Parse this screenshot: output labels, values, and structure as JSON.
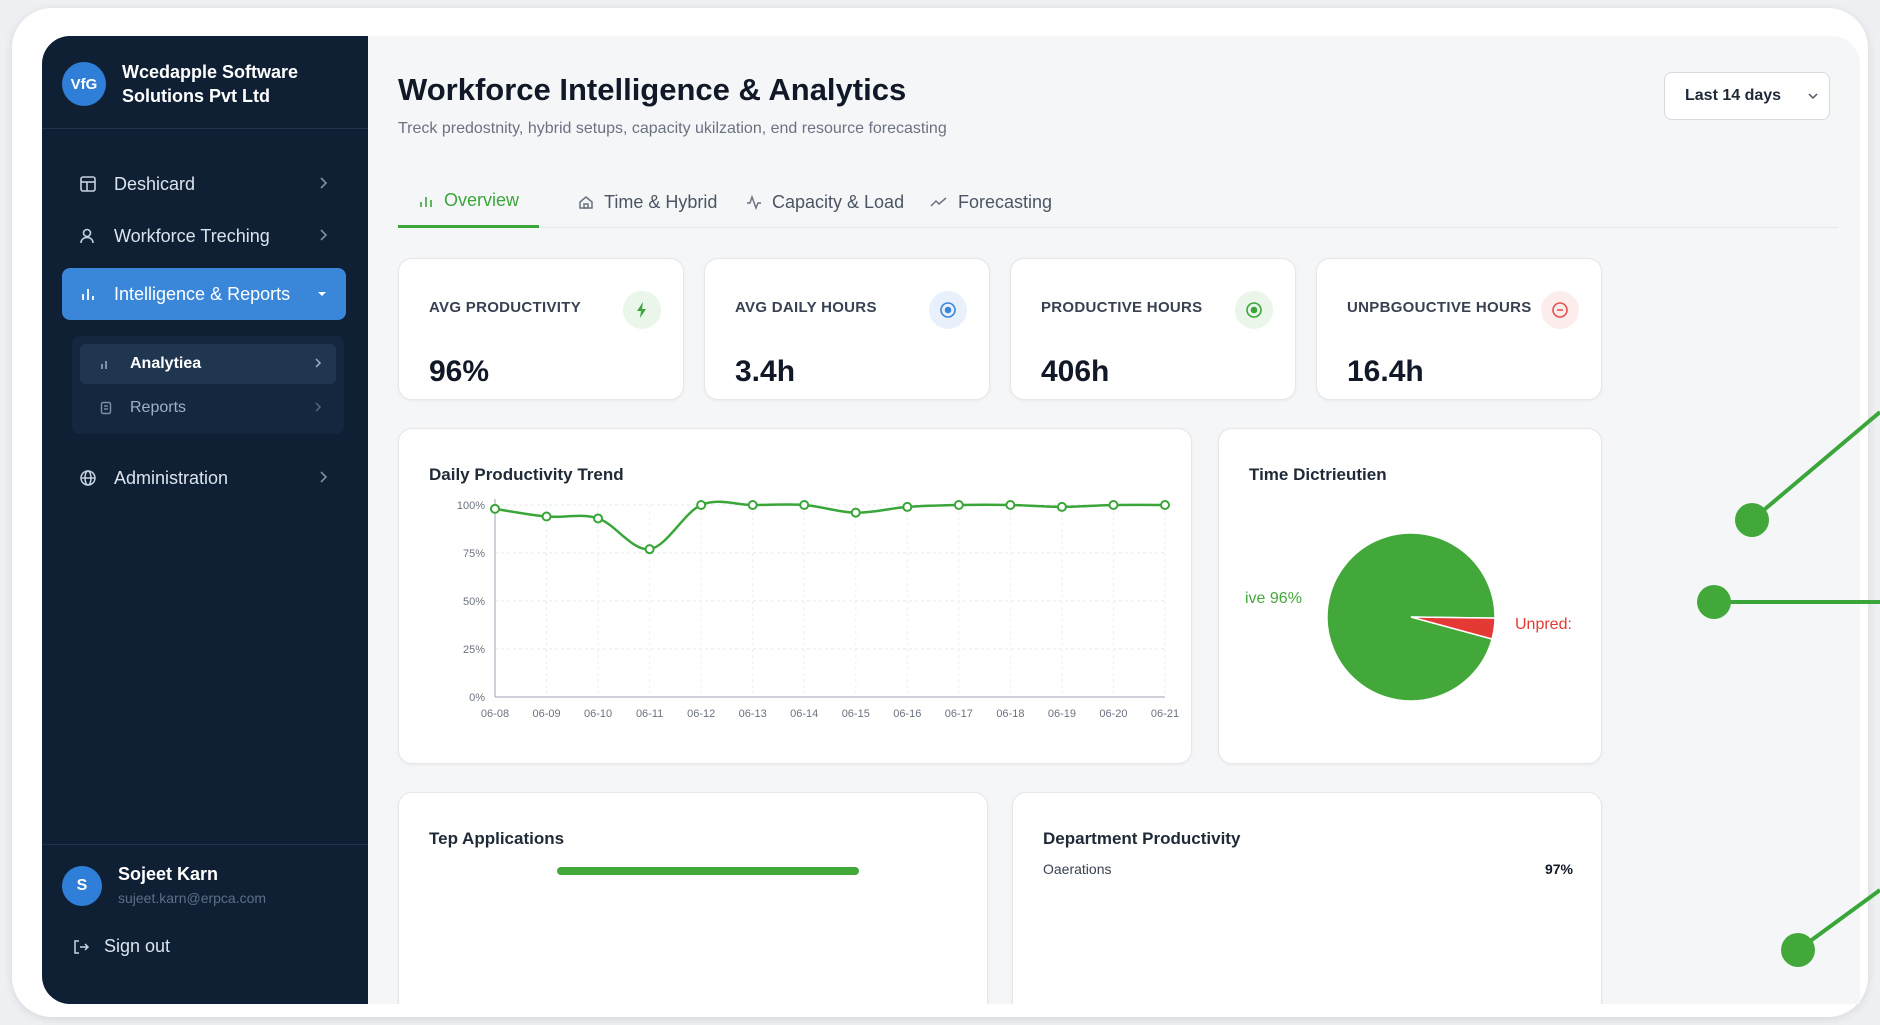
{
  "org": {
    "initials": "VfG",
    "name": "Wcedapple Software Solutions Pvt Ltd"
  },
  "nav": {
    "dashboard": "Deshicard",
    "workforce": "Workforce Treching",
    "intelligence": "Intelligence & Reports",
    "analytics": "Analytiea",
    "reports": "Reports",
    "administration": "Administration"
  },
  "user": {
    "initial": "S",
    "name": "Sojeet Karn",
    "email": "sujeet.karn@erpca.com"
  },
  "signout_label": "Sign out",
  "header": {
    "title": "Workforce Intelligence & Analytics",
    "subtitle": "Treck predostnity, hybrid setups, capacity ukilzation, end resource forecasting",
    "range": "Last 14 days"
  },
  "tabs": [
    "Overview",
    "Time & Hybrid",
    "Capacity & Load",
    "Forecasting"
  ],
  "kpis": [
    {
      "label": "AVG PRODUCTIVITY",
      "value": "96%",
      "color": "#3aa63a"
    },
    {
      "label": "AVG DAILY HOURS",
      "value": "3.4h",
      "color": "#3a86d9"
    },
    {
      "label": "PRODUCTIVE HOURS",
      "value": "406h",
      "color": "#3aa63a"
    },
    {
      "label": "UNPBGOUCTIVE HOURS",
      "value": "16.4h",
      "color": "#e35050"
    }
  ],
  "trend_title": "Daily Productivity Trend",
  "dist_title": "Time Dictrieutien",
  "apps_title": "Tep Applications",
  "dept_title": "Department Productivity",
  "dept_rows": [
    {
      "name": "Oaerations",
      "value": "97%"
    }
  ],
  "colors": {
    "accent": "#3aa63a",
    "sidebar": "#0f2035",
    "active_nav": "#3a86d9",
    "unproductive": "#e53935"
  },
  "chart_data": [
    {
      "type": "line",
      "title": "Daily Productivity Trend",
      "x": [
        "06-08",
        "06-09",
        "06-10",
        "06-11",
        "06-12",
        "06-13",
        "06-14",
        "06-15",
        "06-16",
        "06-17",
        "06-18",
        "06-19",
        "06-20",
        "06-21"
      ],
      "series": [
        {
          "values": [
            98,
            94,
            93,
            77,
            100,
            100,
            100,
            96,
            99,
            100,
            100,
            99,
            100,
            100
          ]
        }
      ],
      "yticks": [
        "0%",
        "25%",
        "50%",
        "75%",
        "100%"
      ],
      "ylim": [
        0,
        100
      ],
      "grid": true
    },
    {
      "type": "pie",
      "title": "Time Dictrieutien",
      "labels": [
        "ive 96%",
        "Unpred:"
      ],
      "values": [
        96,
        4
      ],
      "colors": [
        "#43a83a",
        "#e53935"
      ]
    }
  ]
}
